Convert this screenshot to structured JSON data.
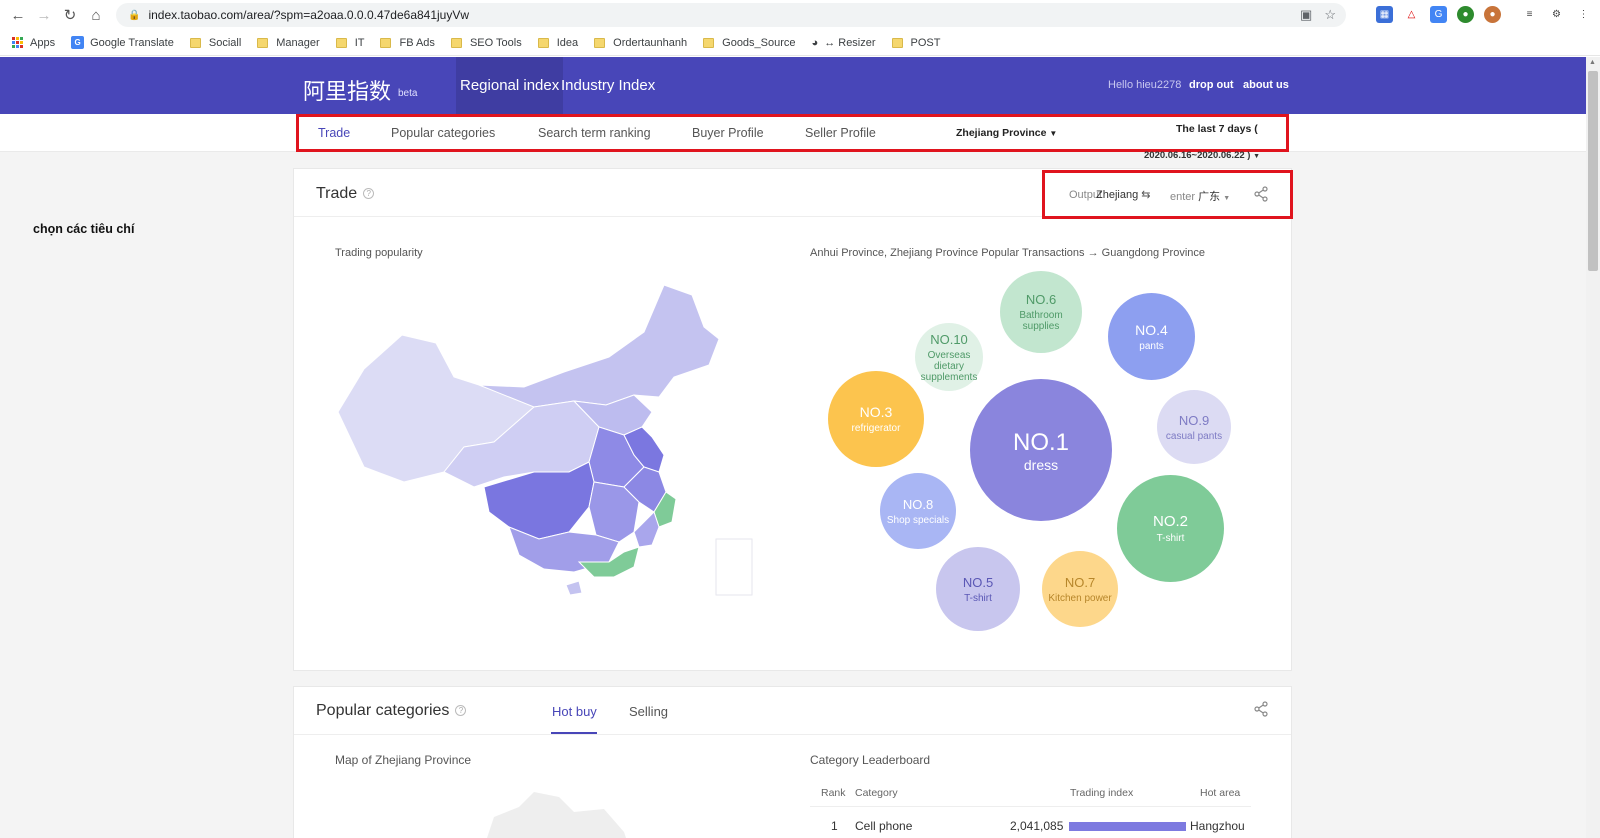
{
  "browser": {
    "url": "index.taobao.com/area/?spm=a2oaa.0.0.0.47de6a841juyVw",
    "bookmarks": [
      "Apps",
      "Google Translate",
      "Sociall",
      "Manager",
      "IT",
      "FB Ads",
      "SEO Tools",
      "Idea",
      "Ordertaunhanh",
      "Goods_Source",
      "↔ Resizer",
      "POST"
    ]
  },
  "header": {
    "logo": "阿里指数",
    "beta": "beta",
    "tabs": [
      "Regional index",
      "Industry Index"
    ],
    "greeting": "Hello hieu2278",
    "drop_out": "drop out",
    "about_us": "about us"
  },
  "subnav": {
    "tabs": [
      "Trade",
      "Popular categories",
      "Search term ranking",
      "Buyer Profile",
      "Seller Profile"
    ],
    "province": "Zhejiang Province",
    "days": "The last 7 days (",
    "date_range": "2020.06.16~2020.06.22 )"
  },
  "side_note": "chọn các tiêu chí",
  "trade": {
    "title": "Trade",
    "output_label": "Output",
    "output_value": "Zhejiang",
    "enter_label": "enter",
    "enter_value": "广东",
    "map_label": "Trading popularity",
    "bubble_caption": "Anhui Province, Zhejiang Province Popular Transactions → Guangdong Province",
    "bubbles": [
      {
        "no": "NO.1",
        "name": "dress"
      },
      {
        "no": "NO.2",
        "name": "T-shirt"
      },
      {
        "no": "NO.3",
        "name": "refrigerator"
      },
      {
        "no": "NO.4",
        "name": "pants"
      },
      {
        "no": "NO.5",
        "name": "T-shirt"
      },
      {
        "no": "NO.6",
        "name": "Bathroom supplies"
      },
      {
        "no": "NO.7",
        "name": "Kitchen power"
      },
      {
        "no": "NO.8",
        "name": "Shop specials"
      },
      {
        "no": "NO.9",
        "name": "casual pants"
      },
      {
        "no": "NO.10",
        "name": "Overseas dietary supplements"
      }
    ],
    "colors": {
      "purple": "#8a85dd",
      "green": "#7fcb98",
      "orange": "#fcc44e",
      "blue": "#8d9ff0"
    }
  },
  "popular": {
    "title": "Popular categories",
    "tabs": [
      "Hot buy",
      "Selling"
    ],
    "map_label": "Map of Zhejiang Province",
    "leaderboard_title": "Category Leaderboard",
    "columns": [
      "Rank",
      "Category",
      "Trading index",
      "Hot area"
    ],
    "rows": [
      {
        "rank": "1",
        "category": "Cell phone",
        "index": "2,041,085",
        "area": "Hangzhou"
      }
    ]
  }
}
